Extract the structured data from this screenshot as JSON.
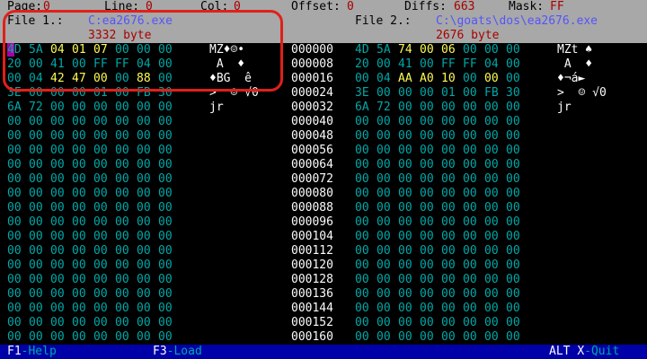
{
  "status": {
    "page_label": "Page:",
    "page_value": "0",
    "line_label": "Line:",
    "line_value": "0",
    "col_label": "Col:",
    "col_value": "0",
    "offset_label": "Offset:",
    "offset_value": "0",
    "diffs_label": "Diffs:",
    "diffs_value": "663",
    "mask_label": "Mask:",
    "mask_value": "FF"
  },
  "file1": {
    "label": "File 1.:",
    "path": "C:ea2676.exe",
    "size": "3332 byte"
  },
  "file2": {
    "label": "File 2.:",
    "path": "C:\\goats\\dos\\ea2676.exe",
    "size": "2676 byte"
  },
  "colors": {
    "bg": "#000000",
    "hex": "#00a8a8",
    "diff": "#fcfc54",
    "header_bg": "#a8a8a8",
    "bar_bg": "#0000a8",
    "highlight": "#e0201a"
  },
  "left_rows": [
    {
      "bytes": [
        "4D",
        "5A",
        "04",
        "01",
        "07",
        "00",
        "00",
        "00"
      ],
      "diff": [
        0,
        0,
        1,
        1,
        1,
        0,
        0,
        0
      ],
      "ascii": "MZ♦☺•"
    },
    {
      "bytes": [
        "20",
        "00",
        "41",
        "00",
        "FF",
        "FF",
        "04",
        "00"
      ],
      "diff": [
        0,
        0,
        0,
        0,
        0,
        0,
        0,
        0
      ],
      "ascii": " A  ♦"
    },
    {
      "bytes": [
        "00",
        "04",
        "42",
        "47",
        "00",
        "00",
        "88",
        "00"
      ],
      "diff": [
        0,
        0,
        1,
        1,
        1,
        0,
        1,
        0
      ],
      "ascii": "♦BG  ê"
    },
    {
      "bytes": [
        "3E",
        "00",
        "00",
        "00",
        "01",
        "00",
        "FB",
        "30"
      ],
      "diff": [
        0,
        0,
        0,
        0,
        0,
        0,
        0,
        0
      ],
      "ascii": ">  ☺ √0"
    },
    {
      "bytes": [
        "6A",
        "72",
        "00",
        "00",
        "00",
        "00",
        "00",
        "00"
      ],
      "diff": [
        0,
        0,
        0,
        0,
        0,
        0,
        0,
        0
      ],
      "ascii": "jr"
    },
    {
      "bytes": [
        "00",
        "00",
        "00",
        "00",
        "00",
        "00",
        "00",
        "00"
      ],
      "diff": [
        0,
        0,
        0,
        0,
        0,
        0,
        0,
        0
      ],
      "ascii": ""
    },
    {
      "bytes": [
        "00",
        "00",
        "00",
        "00",
        "00",
        "00",
        "00",
        "00"
      ],
      "diff": [
        0,
        0,
        0,
        0,
        0,
        0,
        0,
        0
      ],
      "ascii": ""
    },
    {
      "bytes": [
        "00",
        "00",
        "00",
        "00",
        "00",
        "00",
        "00",
        "00"
      ],
      "diff": [
        0,
        0,
        0,
        0,
        0,
        0,
        0,
        0
      ],
      "ascii": ""
    },
    {
      "bytes": [
        "00",
        "00",
        "00",
        "00",
        "00",
        "00",
        "00",
        "00"
      ],
      "diff": [
        0,
        0,
        0,
        0,
        0,
        0,
        0,
        0
      ],
      "ascii": ""
    },
    {
      "bytes": [
        "00",
        "00",
        "00",
        "00",
        "00",
        "00",
        "00",
        "00"
      ],
      "diff": [
        0,
        0,
        0,
        0,
        0,
        0,
        0,
        0
      ],
      "ascii": ""
    },
    {
      "bytes": [
        "00",
        "00",
        "00",
        "00",
        "00",
        "00",
        "00",
        "00"
      ],
      "diff": [
        0,
        0,
        0,
        0,
        0,
        0,
        0,
        0
      ],
      "ascii": ""
    },
    {
      "bytes": [
        "00",
        "00",
        "00",
        "00",
        "00",
        "00",
        "00",
        "00"
      ],
      "diff": [
        0,
        0,
        0,
        0,
        0,
        0,
        0,
        0
      ],
      "ascii": ""
    },
    {
      "bytes": [
        "00",
        "00",
        "00",
        "00",
        "00",
        "00",
        "00",
        "00"
      ],
      "diff": [
        0,
        0,
        0,
        0,
        0,
        0,
        0,
        0
      ],
      "ascii": ""
    },
    {
      "bytes": [
        "00",
        "00",
        "00",
        "00",
        "00",
        "00",
        "00",
        "00"
      ],
      "diff": [
        0,
        0,
        0,
        0,
        0,
        0,
        0,
        0
      ],
      "ascii": ""
    },
    {
      "bytes": [
        "00",
        "00",
        "00",
        "00",
        "00",
        "00",
        "00",
        "00"
      ],
      "diff": [
        0,
        0,
        0,
        0,
        0,
        0,
        0,
        0
      ],
      "ascii": ""
    },
    {
      "bytes": [
        "00",
        "00",
        "00",
        "00",
        "00",
        "00",
        "00",
        "00"
      ],
      "diff": [
        0,
        0,
        0,
        0,
        0,
        0,
        0,
        0
      ],
      "ascii": ""
    },
    {
      "bytes": [
        "00",
        "00",
        "00",
        "00",
        "00",
        "00",
        "00",
        "00"
      ],
      "diff": [
        0,
        0,
        0,
        0,
        0,
        0,
        0,
        0
      ],
      "ascii": ""
    },
    {
      "bytes": [
        "00",
        "00",
        "00",
        "00",
        "00",
        "00",
        "00",
        "00"
      ],
      "diff": [
        0,
        0,
        0,
        0,
        0,
        0,
        0,
        0
      ],
      "ascii": ""
    },
    {
      "bytes": [
        "00",
        "00",
        "00",
        "00",
        "00",
        "00",
        "00",
        "00"
      ],
      "diff": [
        0,
        0,
        0,
        0,
        0,
        0,
        0,
        0
      ],
      "ascii": ""
    },
    {
      "bytes": [
        "00",
        "00",
        "00",
        "00",
        "00",
        "00",
        "00",
        "00"
      ],
      "diff": [
        0,
        0,
        0,
        0,
        0,
        0,
        0,
        0
      ],
      "ascii": ""
    },
    {
      "bytes": [
        "00",
        "00",
        "00",
        "00",
        "00",
        "00",
        "00",
        "00"
      ],
      "diff": [
        0,
        0,
        0,
        0,
        0,
        0,
        0,
        0
      ],
      "ascii": ""
    }
  ],
  "right_rows": [
    {
      "offset": "000000",
      "bytes": [
        "4D",
        "5A",
        "74",
        "00",
        "06",
        "00",
        "00",
        "00"
      ],
      "diff": [
        0,
        0,
        1,
        1,
        1,
        0,
        0,
        0
      ],
      "ascii": "MZt ♠"
    },
    {
      "offset": "000008",
      "bytes": [
        "20",
        "00",
        "41",
        "00",
        "FF",
        "FF",
        "04",
        "00"
      ],
      "diff": [
        0,
        0,
        0,
        0,
        0,
        0,
        0,
        0
      ],
      "ascii": " A  ♦"
    },
    {
      "offset": "000016",
      "bytes": [
        "00",
        "04",
        "AA",
        "A0",
        "10",
        "00",
        "00",
        "00"
      ],
      "diff": [
        0,
        0,
        1,
        1,
        1,
        0,
        1,
        0
      ],
      "ascii": "♦¬á►"
    },
    {
      "offset": "000024",
      "bytes": [
        "3E",
        "00",
        "00",
        "00",
        "01",
        "00",
        "FB",
        "30"
      ],
      "diff": [
        0,
        0,
        0,
        0,
        0,
        0,
        0,
        0
      ],
      "ascii": ">  ☺ √0"
    },
    {
      "offset": "000032",
      "bytes": [
        "6A",
        "72",
        "00",
        "00",
        "00",
        "00",
        "00",
        "00"
      ],
      "diff": [
        0,
        0,
        0,
        0,
        0,
        0,
        0,
        0
      ],
      "ascii": "jr"
    },
    {
      "offset": "000040",
      "bytes": [
        "00",
        "00",
        "00",
        "00",
        "00",
        "00",
        "00",
        "00"
      ],
      "diff": [
        0,
        0,
        0,
        0,
        0,
        0,
        0,
        0
      ],
      "ascii": ""
    },
    {
      "offset": "000048",
      "bytes": [
        "00",
        "00",
        "00",
        "00",
        "00",
        "00",
        "00",
        "00"
      ],
      "diff": [
        0,
        0,
        0,
        0,
        0,
        0,
        0,
        0
      ],
      "ascii": ""
    },
    {
      "offset": "000056",
      "bytes": [
        "00",
        "00",
        "00",
        "00",
        "00",
        "00",
        "00",
        "00"
      ],
      "diff": [
        0,
        0,
        0,
        0,
        0,
        0,
        0,
        0
      ],
      "ascii": ""
    },
    {
      "offset": "000064",
      "bytes": [
        "00",
        "00",
        "00",
        "00",
        "00",
        "00",
        "00",
        "00"
      ],
      "diff": [
        0,
        0,
        0,
        0,
        0,
        0,
        0,
        0
      ],
      "ascii": ""
    },
    {
      "offset": "000072",
      "bytes": [
        "00",
        "00",
        "00",
        "00",
        "00",
        "00",
        "00",
        "00"
      ],
      "diff": [
        0,
        0,
        0,
        0,
        0,
        0,
        0,
        0
      ],
      "ascii": ""
    },
    {
      "offset": "000080",
      "bytes": [
        "00",
        "00",
        "00",
        "00",
        "00",
        "00",
        "00",
        "00"
      ],
      "diff": [
        0,
        0,
        0,
        0,
        0,
        0,
        0,
        0
      ],
      "ascii": ""
    },
    {
      "offset": "000088",
      "bytes": [
        "00",
        "00",
        "00",
        "00",
        "00",
        "00",
        "00",
        "00"
      ],
      "diff": [
        0,
        0,
        0,
        0,
        0,
        0,
        0,
        0
      ],
      "ascii": ""
    },
    {
      "offset": "000096",
      "bytes": [
        "00",
        "00",
        "00",
        "00",
        "00",
        "00",
        "00",
        "00"
      ],
      "diff": [
        0,
        0,
        0,
        0,
        0,
        0,
        0,
        0
      ],
      "ascii": ""
    },
    {
      "offset": "000104",
      "bytes": [
        "00",
        "00",
        "00",
        "00",
        "00",
        "00",
        "00",
        "00"
      ],
      "diff": [
        0,
        0,
        0,
        0,
        0,
        0,
        0,
        0
      ],
      "ascii": ""
    },
    {
      "offset": "000112",
      "bytes": [
        "00",
        "00",
        "00",
        "00",
        "00",
        "00",
        "00",
        "00"
      ],
      "diff": [
        0,
        0,
        0,
        0,
        0,
        0,
        0,
        0
      ],
      "ascii": ""
    },
    {
      "offset": "000120",
      "bytes": [
        "00",
        "00",
        "00",
        "00",
        "00",
        "00",
        "00",
        "00"
      ],
      "diff": [
        0,
        0,
        0,
        0,
        0,
        0,
        0,
        0
      ],
      "ascii": ""
    },
    {
      "offset": "000128",
      "bytes": [
        "00",
        "00",
        "00",
        "00",
        "00",
        "00",
        "00",
        "00"
      ],
      "diff": [
        0,
        0,
        0,
        0,
        0,
        0,
        0,
        0
      ],
      "ascii": ""
    },
    {
      "offset": "000136",
      "bytes": [
        "00",
        "00",
        "00",
        "00",
        "00",
        "00",
        "00",
        "00"
      ],
      "diff": [
        0,
        0,
        0,
        0,
        0,
        0,
        0,
        0
      ],
      "ascii": ""
    },
    {
      "offset": "000144",
      "bytes": [
        "00",
        "00",
        "00",
        "00",
        "00",
        "00",
        "00",
        "00"
      ],
      "diff": [
        0,
        0,
        0,
        0,
        0,
        0,
        0,
        0
      ],
      "ascii": ""
    },
    {
      "offset": "000152",
      "bytes": [
        "00",
        "00",
        "00",
        "00",
        "00",
        "00",
        "00",
        "00"
      ],
      "diff": [
        0,
        0,
        0,
        0,
        0,
        0,
        0,
        0
      ],
      "ascii": ""
    },
    {
      "offset": "000160",
      "bytes": [
        "00",
        "00",
        "00",
        "00",
        "00",
        "00",
        "00",
        "00"
      ],
      "diff": [
        0,
        0,
        0,
        0,
        0,
        0,
        0,
        0
      ],
      "ascii": ""
    }
  ],
  "bottom": {
    "f1_key": "F1",
    "f1_label": "-Help",
    "f3_key": "F3",
    "f3_label": "-Load",
    "alt_key": "ALT",
    "x_key": "X",
    "quit_label": "-Quit"
  }
}
